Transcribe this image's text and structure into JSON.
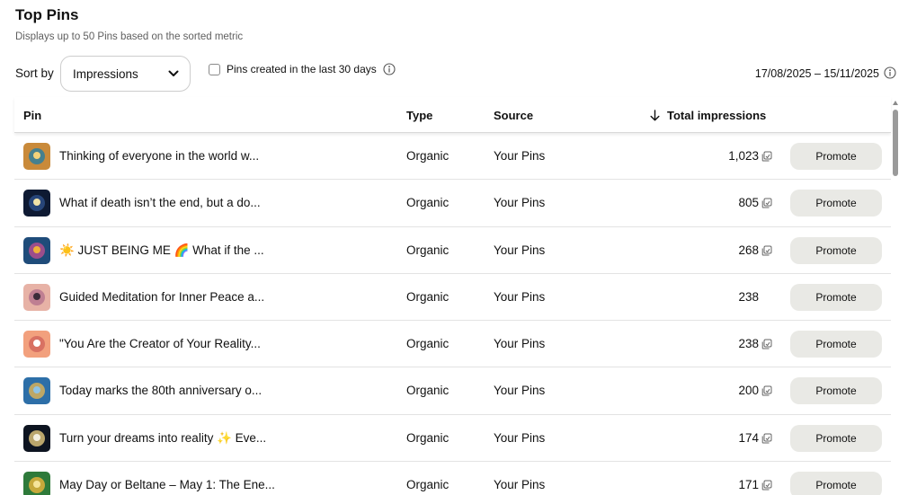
{
  "header": {
    "title": "Top Pins",
    "subtitle": "Displays up to 50 Pins based on the sorted metric"
  },
  "controls": {
    "sort_label": "Sort by",
    "sort_value": "Impressions",
    "filter_label": "Pins created in the last 30 days",
    "filter_checked": false,
    "date_range": "17/08/2025 – 15/11/2025"
  },
  "table": {
    "columns": {
      "pin": "Pin",
      "type": "Type",
      "source": "Source",
      "impressions": "Total impressions"
    },
    "sort_direction_icon": "arrow-down-icon",
    "rows": [
      {
        "title": "Thinking of everyone in the world w...",
        "type": "Organic",
        "source": "Your Pins",
        "impressions": "1,023",
        "has_copy_icon": true,
        "action": "Promote",
        "thumb_colors": [
          "#c98a3a",
          "#2f7e9e",
          "#f2d27a"
        ]
      },
      {
        "title": "What if death isn’t the end, but a do...",
        "type": "Organic",
        "source": "Your Pins",
        "impressions": "805",
        "has_copy_icon": true,
        "action": "Promote",
        "thumb_colors": [
          "#0e1a33",
          "#2c4d86",
          "#f1e2a8"
        ]
      },
      {
        "title": "☀️ JUST BEING ME 🌈 What if the ...",
        "type": "Organic",
        "source": "Your Pins",
        "impressions": "268",
        "has_copy_icon": true,
        "action": "Promote",
        "thumb_colors": [
          "#1f4c7a",
          "#b34f8e",
          "#f0b23a"
        ]
      },
      {
        "title": "Guided Meditation for Inner Peace a...",
        "type": "Organic",
        "source": "Your Pins",
        "impressions": "238",
        "has_copy_icon": false,
        "action": "Promote",
        "thumb_colors": [
          "#e7b2a6",
          "#b7768e",
          "#3b2b3a"
        ]
      },
      {
        "title": "\"You Are the Creator of Your Reality...",
        "type": "Organic",
        "source": "Your Pins",
        "impressions": "238",
        "has_copy_icon": true,
        "action": "Promote",
        "thumb_colors": [
          "#f2a07d",
          "#d4685e",
          "#ffffff"
        ]
      },
      {
        "title": "Today marks the 80th anniversary o...",
        "type": "Organic",
        "source": "Your Pins",
        "impressions": "200",
        "has_copy_icon": true,
        "action": "Promote",
        "thumb_colors": [
          "#2d6fa8",
          "#d7b25a",
          "#8fc4e6"
        ]
      },
      {
        "title": "Turn your dreams into reality ✨ Eve...",
        "type": "Organic",
        "source": "Your Pins",
        "impressions": "174",
        "has_copy_icon": true,
        "action": "Promote",
        "thumb_colors": [
          "#0d1420",
          "#d9c07a",
          "#f4f0e0"
        ]
      },
      {
        "title": "May Day or Beltane – May 1: The Ene...",
        "type": "Organic",
        "source": "Your Pins",
        "impressions": "171",
        "has_copy_icon": true,
        "action": "Promote",
        "thumb_colors": [
          "#2e7a3a",
          "#e0b23c",
          "#f6e59a"
        ]
      }
    ]
  },
  "colors": {
    "promote_bg": "#e9e9e5",
    "divider": "#e3e3e3",
    "muted_text": "#5f5f5f"
  }
}
